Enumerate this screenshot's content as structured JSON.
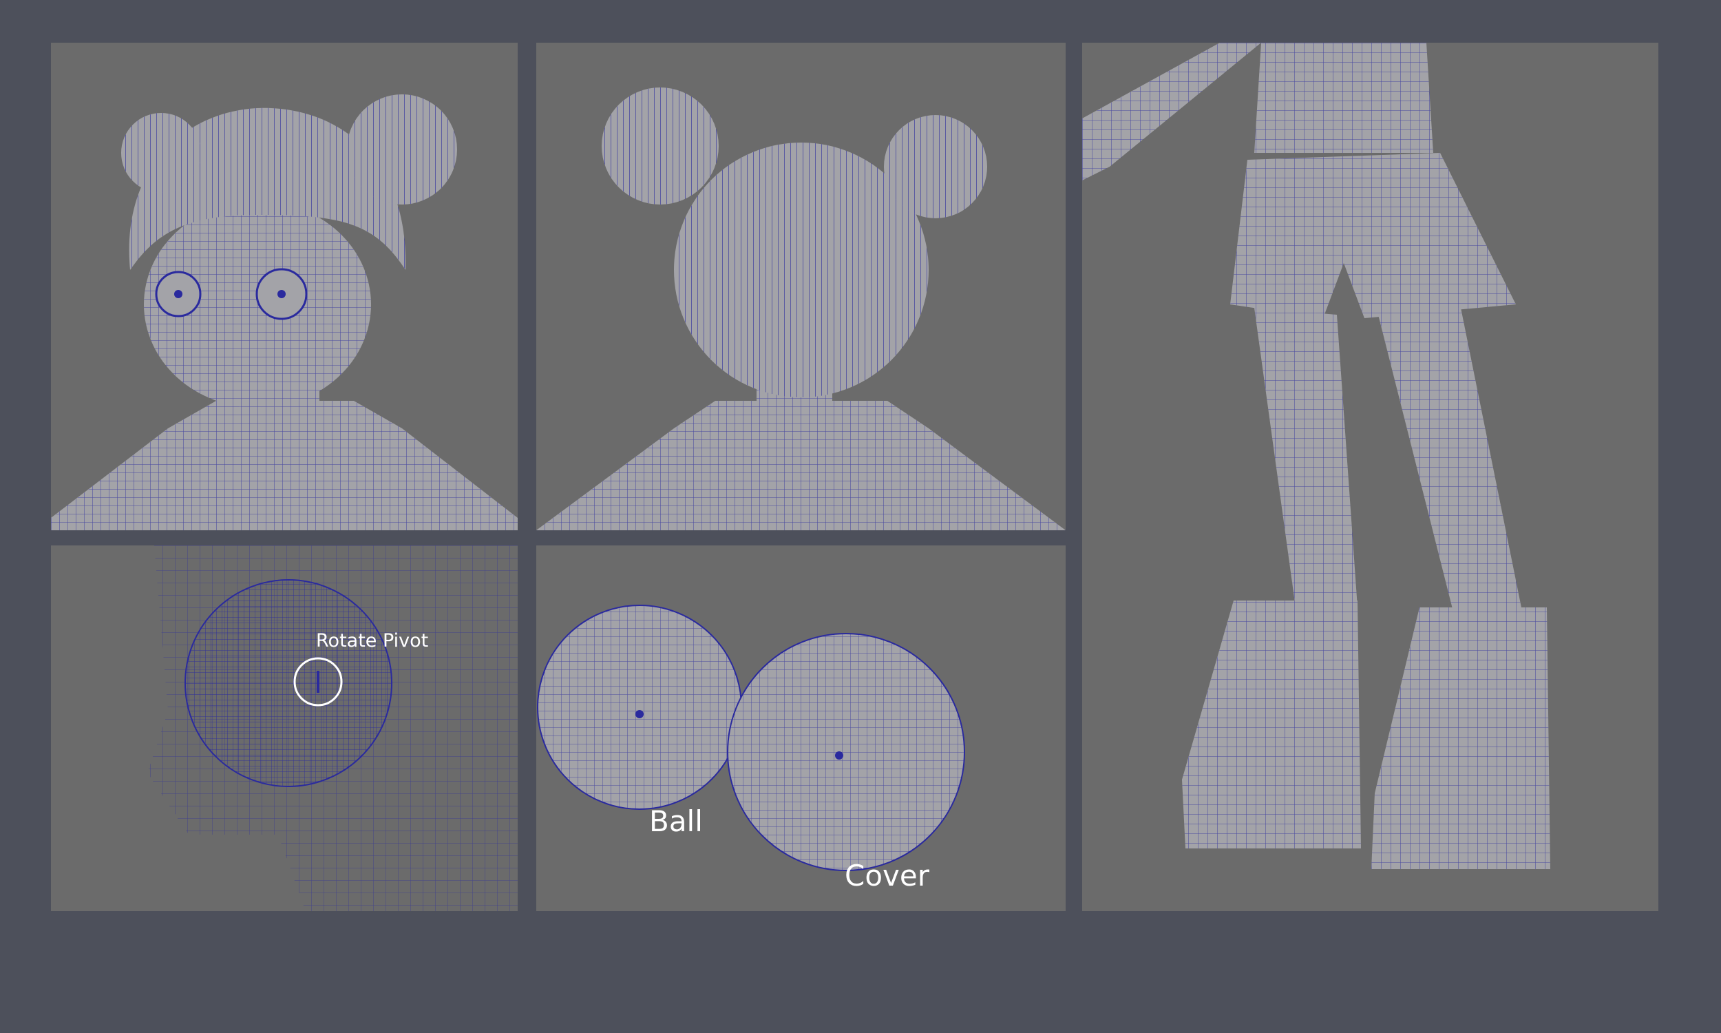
{
  "labels": {
    "rotate_pivot": "Rotate Pivot",
    "ball": "Ball",
    "cover": "Cover"
  },
  "colors": {
    "background": "#4d505b",
    "panel": "#6b6b6b",
    "mesh_fill": "#a3a3a8",
    "wire": "#2a2a9e",
    "label": "#ffffff"
  }
}
